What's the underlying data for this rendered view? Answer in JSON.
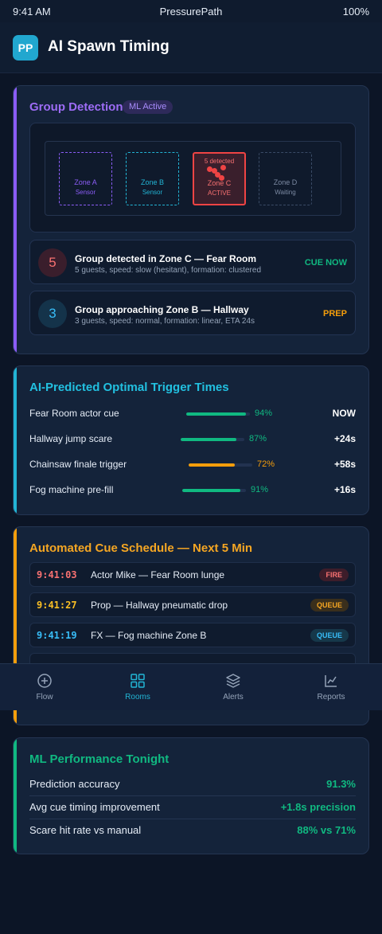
{
  "status": {
    "time": "9:41 AM",
    "carrier": "PressurePath",
    "battery": "100%"
  },
  "app": {
    "logo": "PP",
    "title": "AI Spawn Timing"
  },
  "group_detection": {
    "title": "Group Detection",
    "badge": "ML Active",
    "zones": [
      {
        "name": "Zone A",
        "state": "Sensor"
      },
      {
        "name": "Zone B",
        "state": "Sensor"
      },
      {
        "name": "Zone C",
        "state": "ACTIVE",
        "detected": "5 detected"
      },
      {
        "name": "Zone D",
        "state": "Waiting"
      }
    ],
    "alerts": [
      {
        "count": "5",
        "title": "Group detected in Zone C — Fear Room",
        "detail": "5 guests, speed: slow (hesitant), formation: clustered",
        "action": "CUE NOW"
      },
      {
        "count": "3",
        "title": "Group approaching Zone B — Hallway",
        "detail": "3 guests, speed: normal, formation: linear, ETA 24s",
        "action": "PREP"
      }
    ]
  },
  "triggers": {
    "title": "AI-Predicted Optimal Trigger Times",
    "rows": [
      {
        "label": "Fear Room actor cue",
        "confidence": 0.94,
        "pct": "94%",
        "color": "#10b981",
        "when": "NOW"
      },
      {
        "label": "Hallway jump scare",
        "confidence": 0.87,
        "pct": "87%",
        "color": "#10b981",
        "when": "+24s"
      },
      {
        "label": "Chainsaw finale trigger",
        "confidence": 0.72,
        "pct": "72%",
        "color": "#f59e0b",
        "when": "+58s"
      },
      {
        "label": "Fog machine pre-fill",
        "confidence": 0.91,
        "pct": "91%",
        "color": "#10b981",
        "when": "+16s"
      }
    ]
  },
  "schedule": {
    "title": "Automated Cue Schedule — Next 5 Min",
    "rows": [
      {
        "time": "9:41:03",
        "desc": "Actor Mike — Fear Room lunge",
        "status": "FIRE"
      },
      {
        "time": "9:41:27",
        "desc": "Prop — Hallway pneumatic drop",
        "status": "QUEUE"
      },
      {
        "time": "9:41:19",
        "desc": "FX — Fog machine Zone B",
        "status": "QUEUE"
      }
    ]
  },
  "tabs": [
    {
      "label": "Flow",
      "icon": "plus-circle-icon"
    },
    {
      "label": "Rooms",
      "icon": "grid-icon"
    },
    {
      "label": "Alerts",
      "icon": "layers-icon"
    },
    {
      "label": "Reports",
      "icon": "chart-line-icon"
    }
  ],
  "performance": {
    "title": "ML Performance Tonight",
    "rows": [
      {
        "label": "Prediction accuracy",
        "value": "91.3%"
      },
      {
        "label": "Avg cue timing improvement",
        "value": "+1.8s precision"
      },
      {
        "label": "Scare hit rate vs manual",
        "value": "88% vs 71%"
      }
    ]
  },
  "colors": {
    "purple": "#8b5cf6",
    "cyan": "#22b5d5",
    "red": "#ef4444",
    "amber": "#f59e0b",
    "green": "#10b981"
  }
}
